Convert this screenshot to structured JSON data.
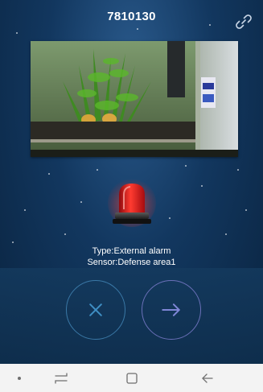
{
  "header": {
    "device_id": "7810130",
    "link_icon": "link-icon"
  },
  "camera": {
    "description_icon": "camera-feed"
  },
  "alarm": {
    "icon": "alarm-siren-icon",
    "type_line": "Type:External alarm",
    "sensor_line": "Sensor:Defense area1"
  },
  "actions": {
    "dismiss_icon": "close-icon",
    "go_icon": "arrow-right-icon"
  },
  "navbar": {
    "items": [
      "dot-icon",
      "recent-apps-icon",
      "home-icon",
      "back-icon"
    ]
  },
  "colors": {
    "background": "#12375f",
    "dismiss_ring": "#3a78a6",
    "go_ring": "#6a70b8",
    "alarm_red": "#e0161b"
  }
}
